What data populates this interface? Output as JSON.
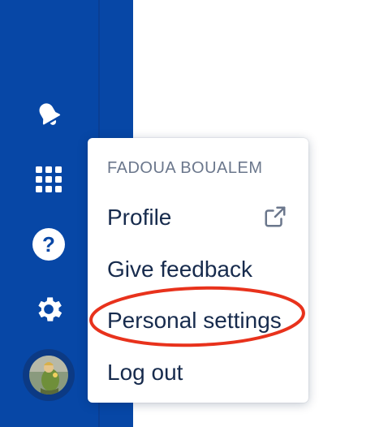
{
  "sidebar": {
    "icons": [
      "notifications-icon",
      "app-switcher-icon",
      "help-icon",
      "settings-icon"
    ],
    "avatar": "user-avatar"
  },
  "menu": {
    "heading": "FADOUA BOUALEM",
    "items": [
      {
        "label": "Profile",
        "icon": "external-link-icon"
      },
      {
        "label": "Give feedback"
      },
      {
        "label": "Personal settings"
      },
      {
        "label": "Log out"
      }
    ]
  },
  "colors": {
    "sidebar": "#0747a6",
    "menu_text": "#172b4d",
    "heading_text": "#6b778c",
    "highlight": "#e8321c"
  }
}
